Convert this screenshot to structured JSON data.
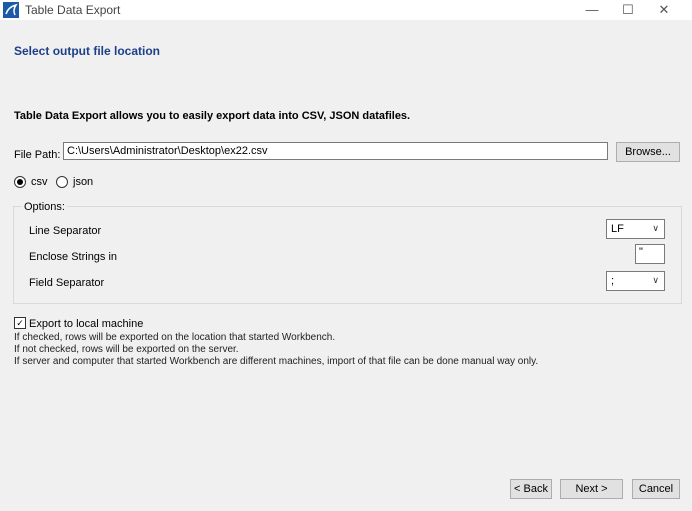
{
  "window": {
    "title": "Table Data Export",
    "minimize_glyph": "—",
    "maximize_glyph": "☐",
    "close_glyph": "✕"
  },
  "page": {
    "heading": "Select output file location",
    "description": "Table Data Export allows you to easily export data into CSV, JSON datafiles."
  },
  "file": {
    "label": "File Path:",
    "value": "C:\\Users\\Administrator\\Desktop\\ex22.csv",
    "browse_label": "Browse..."
  },
  "format": {
    "csv_label": "csv",
    "json_label": "json",
    "selected": "csv"
  },
  "options": {
    "title": "Options:",
    "line_separator_label": "Line Separator",
    "line_separator_value": "LF",
    "enclose_label": "Enclose Strings in",
    "enclose_value": "\"",
    "field_separator_label": "Field Separator",
    "field_separator_value": ";"
  },
  "export_local": {
    "label": "Export to local machine",
    "checked": true,
    "info1": "If checked, rows will be exported on the location that started Workbench.",
    "info2": "If not checked, rows will be exported on the server.",
    "info3": "If server and computer that started Workbench are different machines, import of that file can be done manual way only."
  },
  "buttons": {
    "back": "< Back",
    "next": "Next >",
    "cancel": "Cancel"
  }
}
